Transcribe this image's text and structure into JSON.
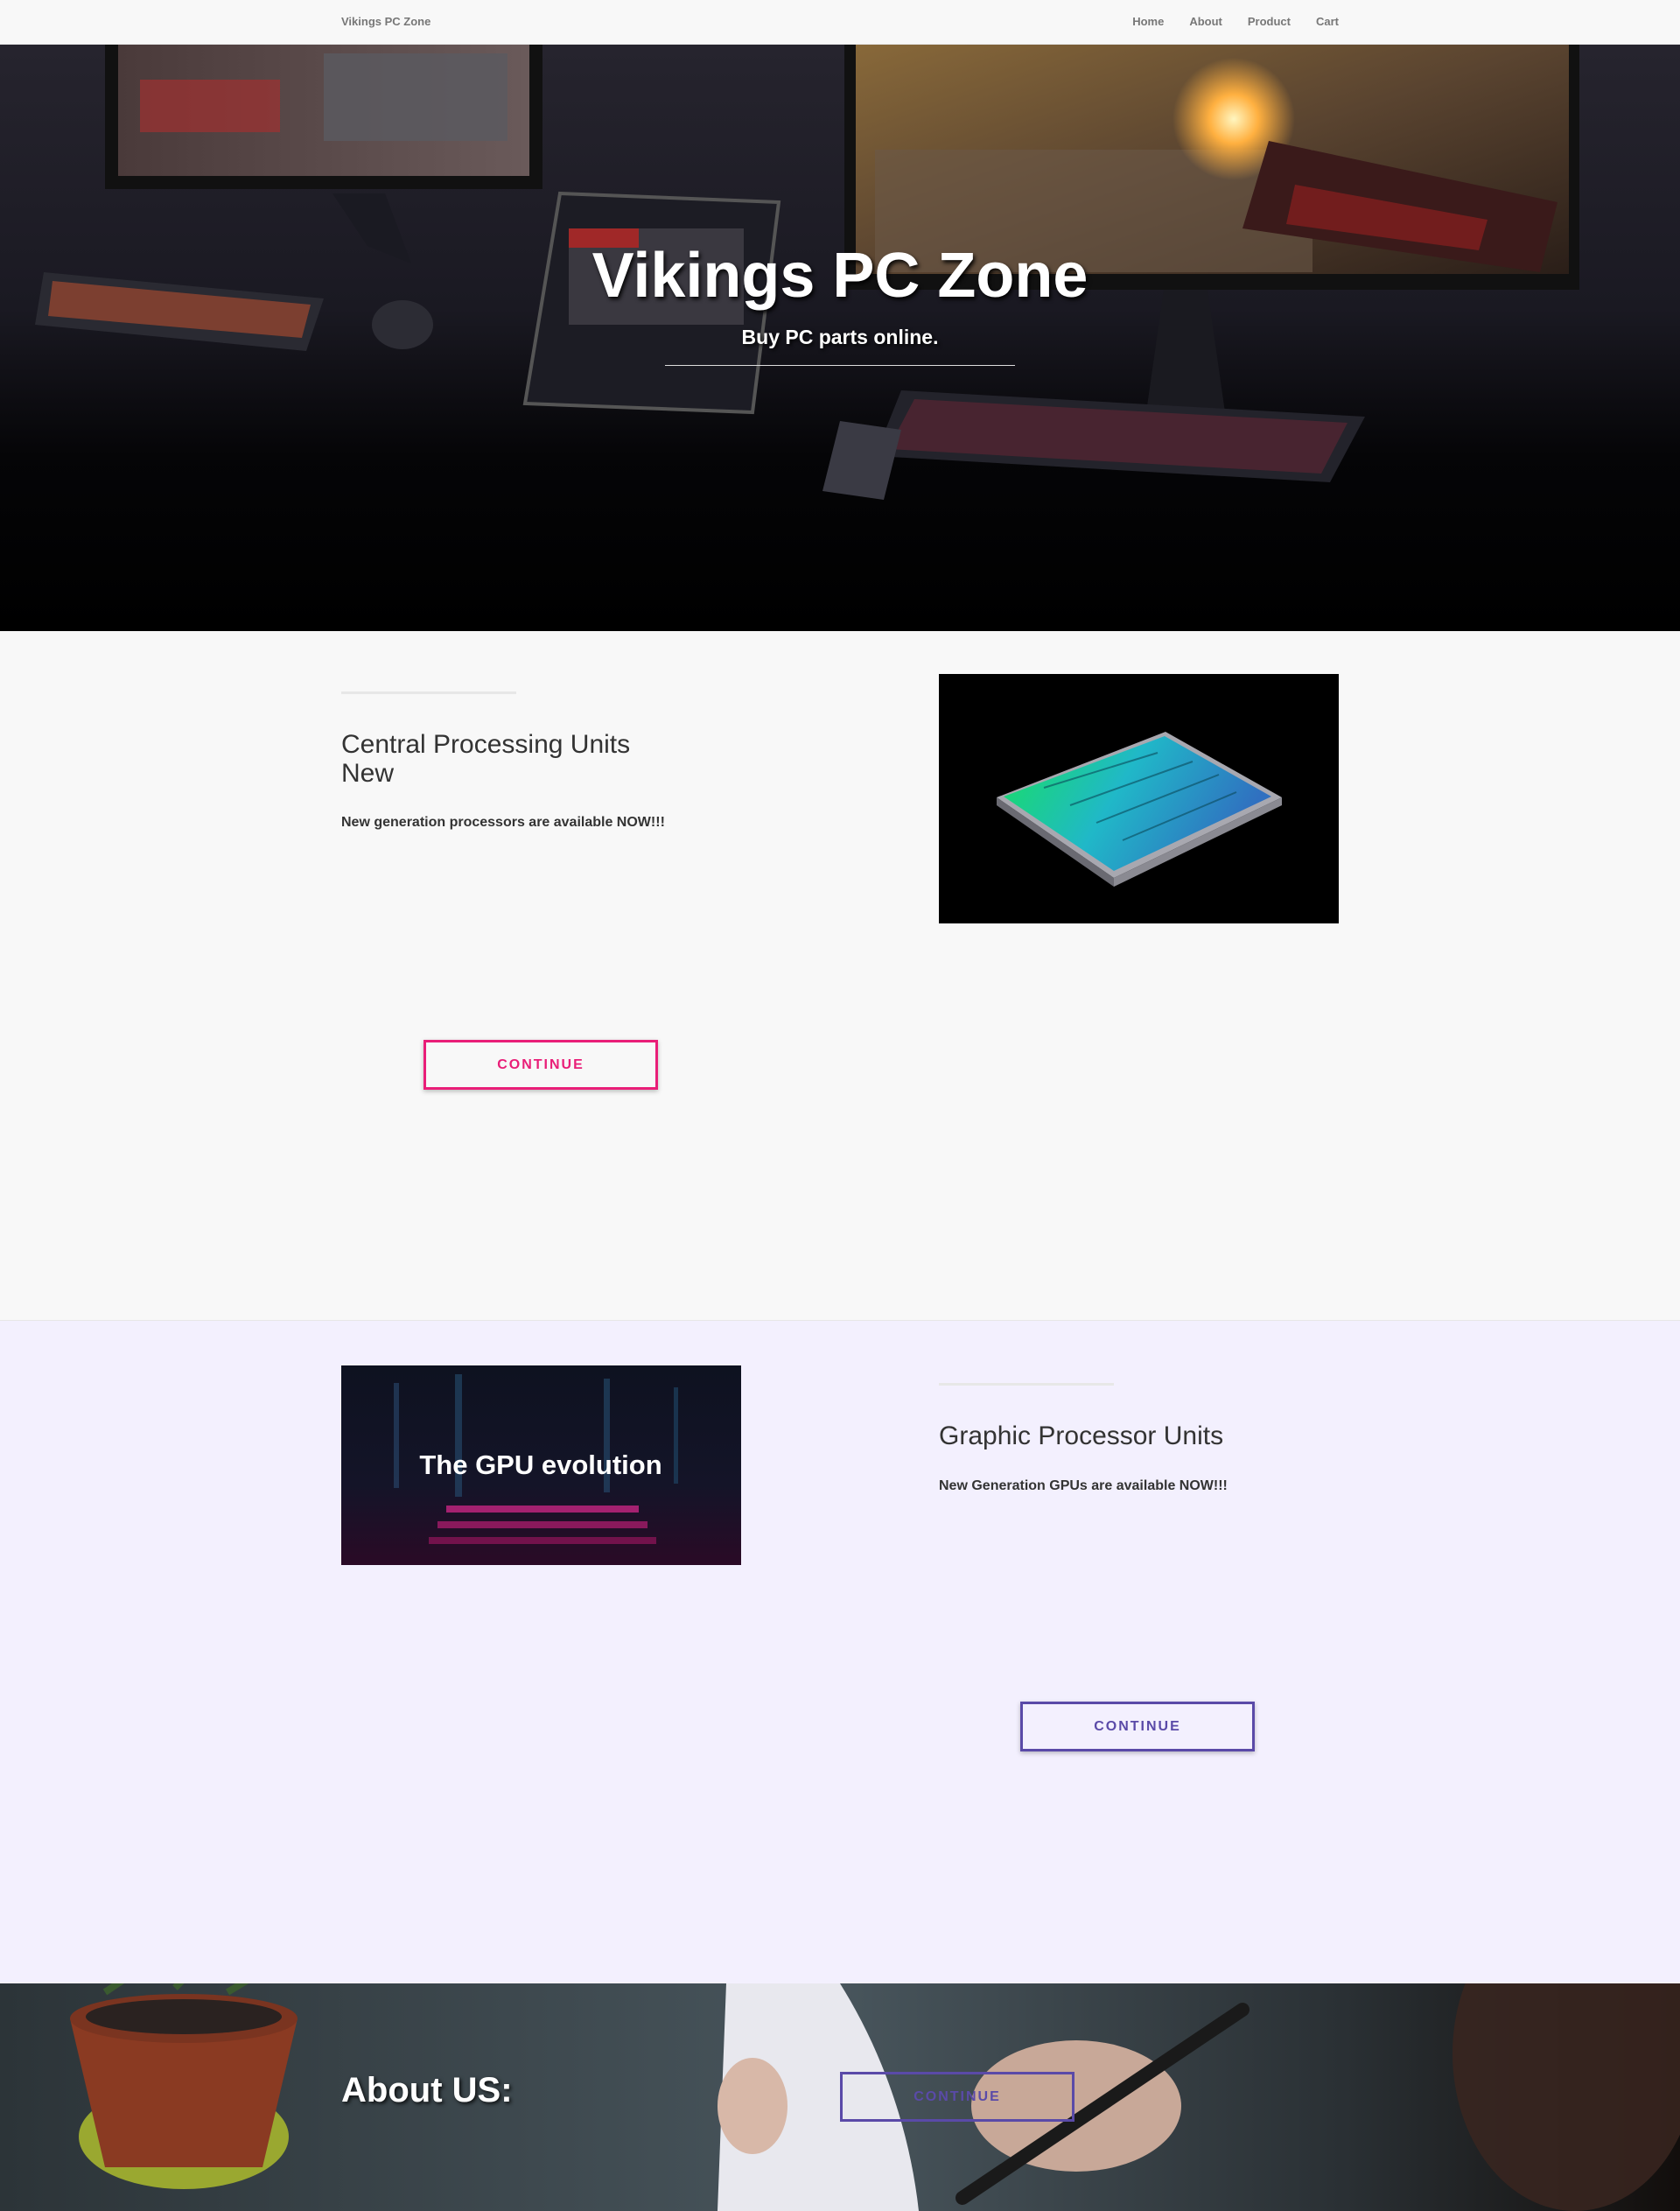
{
  "nav": {
    "brand": "Vikings PC Zone",
    "links": [
      "Home",
      "About",
      "Product",
      "Cart"
    ]
  },
  "hero": {
    "title": "Vikings PC Zone",
    "subtitle": "Buy PC parts online."
  },
  "cpu_section": {
    "heading_line1": "Central Processing Units",
    "heading_line2": "New",
    "text": "New generation processors are available NOW!!!",
    "button": "CONTINUE"
  },
  "gpu_section": {
    "image_caption": "The GPU evolution",
    "heading": "Graphic Processor Units",
    "text": "New Generation GPUs are available NOW!!!",
    "button": "CONTINUE"
  },
  "about": {
    "title": "About US:",
    "button": "CONTINUE"
  },
  "colors": {
    "pink_accent": "#e91e78",
    "purple_accent": "#5a4aa8",
    "section_alt_bg": "#f3f0fe"
  },
  "icons": [
    "hero-desk-image",
    "cpu-chip-image",
    "gpu-evolution-image",
    "about-writing-image"
  ]
}
